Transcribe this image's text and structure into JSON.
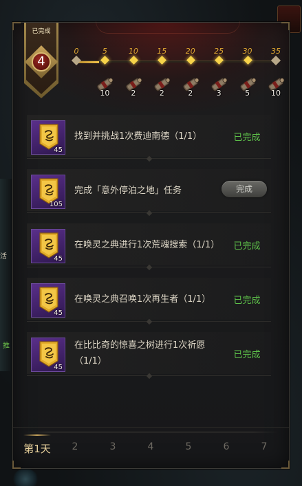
{
  "header": {
    "completed_label": "已完成",
    "progress_value": 4
  },
  "milestones": [
    {
      "threshold": "0",
      "count": null
    },
    {
      "threshold": "5",
      "count": "10"
    },
    {
      "threshold": "10",
      "count": "2"
    },
    {
      "threshold": "15",
      "count": "2"
    },
    {
      "threshold": "20",
      "count": "2"
    },
    {
      "threshold": "25",
      "count": "3"
    },
    {
      "threshold": "30",
      "count": "5"
    },
    {
      "threshold": "35",
      "count": "10"
    }
  ],
  "tasks": [
    {
      "description": "找到并挑战1次费迪南德（1/1）",
      "reward_count": "45",
      "status": "已完成",
      "status_type": "done"
    },
    {
      "description": "完成「意外停泊之地」任务",
      "reward_count": "105",
      "status": "完成",
      "status_type": "button"
    },
    {
      "description": "在唤灵之典进行1次荒魂搜索（1/1）",
      "reward_count": "45",
      "status": "已完成",
      "status_type": "done"
    },
    {
      "description": "在唤灵之典召唤1次再生者（1/1）",
      "reward_count": "45",
      "status": "已完成",
      "status_type": "done"
    },
    {
      "description": "在比比奇的惊喜之树进行1次祈愿（1/1）",
      "reward_count": "45",
      "status": "已完成",
      "status_type": "done"
    }
  ],
  "day_tabs": [
    {
      "label": "第1天",
      "active": true
    },
    {
      "label": "2",
      "active": false
    },
    {
      "label": "3",
      "active": false
    },
    {
      "label": "4",
      "active": false
    },
    {
      "label": "5",
      "active": false
    },
    {
      "label": "6",
      "active": false
    },
    {
      "label": "7",
      "active": false
    }
  ],
  "background": {
    "left_edge_text": "活",
    "left_edge_text_green": "推"
  },
  "colors": {
    "completed_green": "#5ec24a",
    "accent_gold": "#e0a832",
    "reward_purple": "#5a2f8a"
  },
  "icons": {
    "milestone_reward": "scroll-bundle-icon",
    "task_reward": "gold-banner-token-icon"
  }
}
